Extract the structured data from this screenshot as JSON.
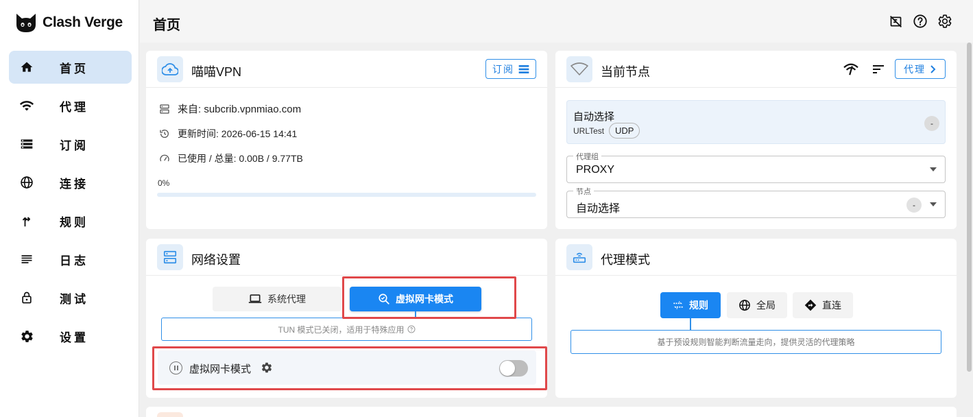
{
  "app": {
    "name": "Clash Verge"
  },
  "sidebar": {
    "items": [
      {
        "label": "首页",
        "icon": "home-icon",
        "active": true
      },
      {
        "label": "代理",
        "icon": "wifi-icon",
        "active": false
      },
      {
        "label": "订阅",
        "icon": "storage-icon",
        "active": false
      },
      {
        "label": "连接",
        "icon": "globe-icon",
        "active": false
      },
      {
        "label": "规则",
        "icon": "fork-icon",
        "active": false
      },
      {
        "label": "日志",
        "icon": "list-icon",
        "active": false
      },
      {
        "label": "测试",
        "icon": "lock-icon",
        "active": false
      },
      {
        "label": "设置",
        "icon": "gear-icon",
        "active": false
      }
    ]
  },
  "header": {
    "title": "首页",
    "icons": [
      "layout-icon",
      "help-icon",
      "settings-icon"
    ]
  },
  "profile": {
    "title": "喵喵VPN",
    "subscribe_label": "订阅",
    "from": "来自: subcrib.vpnmiao.com",
    "updated": "更新时间: 2026-06-15 14:41",
    "usage": "已使用 / 总量: 0.00B / 9.77TB",
    "percent_label": "0%",
    "percent": 0
  },
  "current_node": {
    "title": "当前节点",
    "proxy_label": "代理",
    "node_name": "自动选择",
    "node_type": "URLTest",
    "udp_label": "UDP",
    "delay": "-",
    "group_field": {
      "label": "代理组",
      "value": "PROXY"
    },
    "node_field": {
      "label": "节点",
      "value": "自动选择",
      "delay": "-"
    }
  },
  "network": {
    "title": "网络设置",
    "system_proxy_label": "系统代理",
    "tun_label": "虚拟网卡模式",
    "hint": "TUN 模式已关闭，适用于特殊应用",
    "tun_row_label": "虚拟网卡模式",
    "tun_enabled": false
  },
  "proxy_mode": {
    "title": "代理模式",
    "rule_label": "规则",
    "global_label": "全局",
    "direct_label": "直连",
    "selected": "rule",
    "hint": "基于预设规则智能判断流量走向，提供灵活的代理策略"
  },
  "colors": {
    "accent": "#1a86f2",
    "highlight": "#e0484a",
    "active_nav": "#d6e6f7"
  }
}
